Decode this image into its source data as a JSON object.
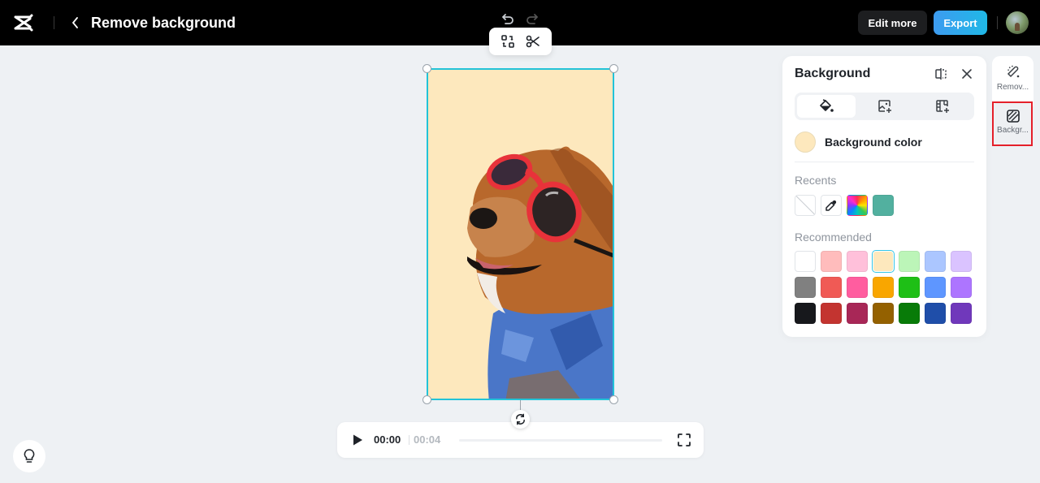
{
  "header": {
    "title": "Remove background",
    "edit_more_label": "Edit more",
    "export_label": "Export"
  },
  "player": {
    "current_time": "00:00",
    "duration": "00:04",
    "progress": 0
  },
  "panel": {
    "title": "Background",
    "tabs": [
      {
        "icon": "paint-bucket-icon",
        "active": true
      },
      {
        "icon": "image-add-icon",
        "active": false
      },
      {
        "icon": "video-add-icon",
        "active": false
      }
    ],
    "background_color_label": "Background color",
    "background_color": "#fde8bd",
    "recents_label": "Recents",
    "recents": [
      {
        "type": "none"
      },
      {
        "type": "eyedropper"
      },
      {
        "type": "custom-spectrum"
      },
      {
        "type": "color",
        "color": "#52b09f"
      }
    ],
    "recommended_label": "Recommended",
    "recommended": [
      "#ffffff",
      "#ffbcbc",
      "#ffc0da",
      "#fde8bd",
      "#bcf5b8",
      "#abc6ff",
      "#dac3ff",
      "#808080",
      "#f05a55",
      "#ff5d9f",
      "#f9a600",
      "#1ebf16",
      "#5e96ff",
      "#ad75ff",
      "#17181c",
      "#c33430",
      "#a82757",
      "#946100",
      "#087b08",
      "#1f4ea9",
      "#7038bb"
    ],
    "selected_color": "#fde8bd"
  },
  "rail": {
    "items": [
      {
        "label": "Remov...",
        "icon": "magic-eraser-icon"
      },
      {
        "label": "Backgr...",
        "icon": "background-icon",
        "active": true
      }
    ]
  },
  "canvas": {
    "background_color": "#fde8bd",
    "selection_color": "#22c3d8"
  }
}
